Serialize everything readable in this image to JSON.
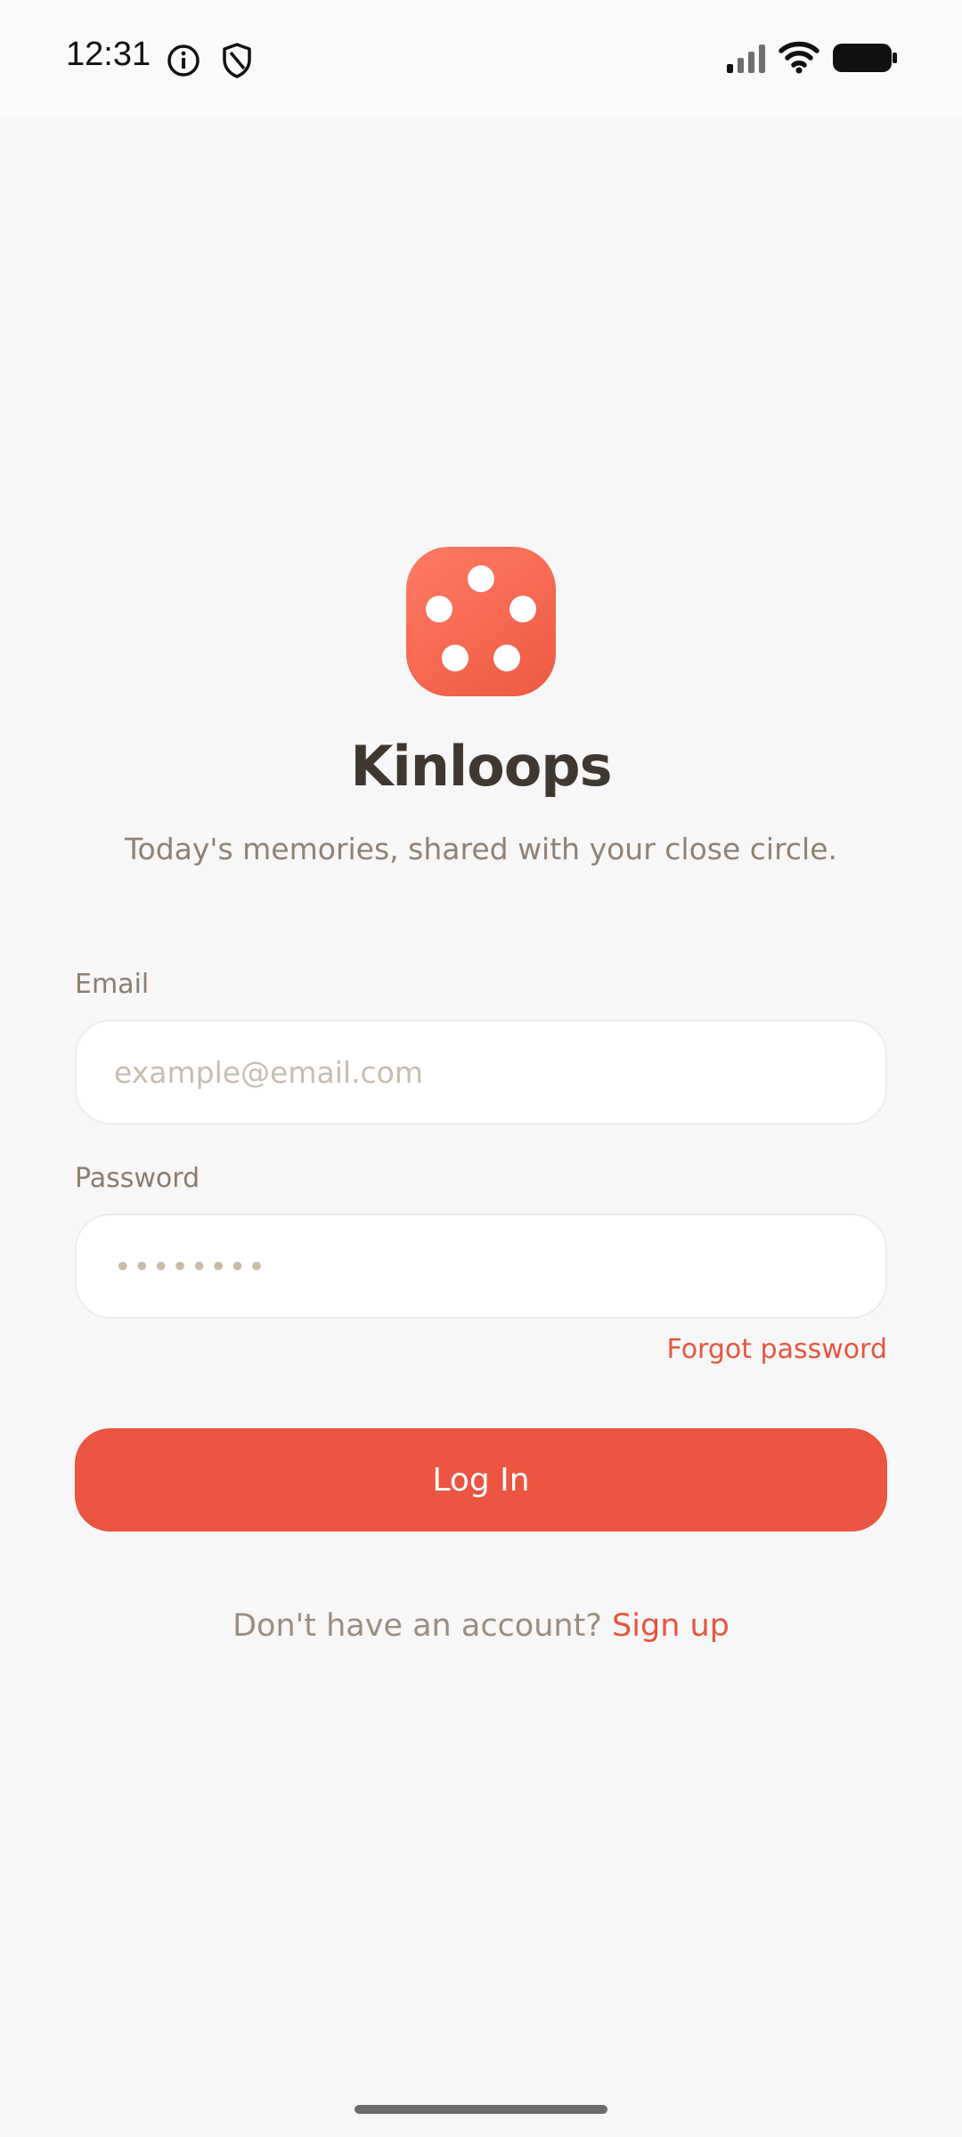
{
  "status_bar": {
    "time": "12:31",
    "icons": [
      "info-icon",
      "shield-icon",
      "signal-icon",
      "wifi-icon",
      "battery-icon"
    ]
  },
  "app": {
    "name": "Kinloops",
    "tagline": "Today's memories, shared with your close circle.",
    "logo_icon": "five-dots-logo-icon"
  },
  "form": {
    "email_label": "Email",
    "email_placeholder": "example@email.com",
    "email_value": "",
    "password_label": "Password",
    "password_value": "••••••••",
    "forgot_password": "Forgot password",
    "login_button": "Log In"
  },
  "signup": {
    "prompt": "Don't have an account?",
    "link": "Sign up"
  },
  "colors": {
    "accent": "#eb5541",
    "background": "#f7f7f7",
    "title_text": "#3f3831",
    "secondary_text": "#8f8275"
  }
}
